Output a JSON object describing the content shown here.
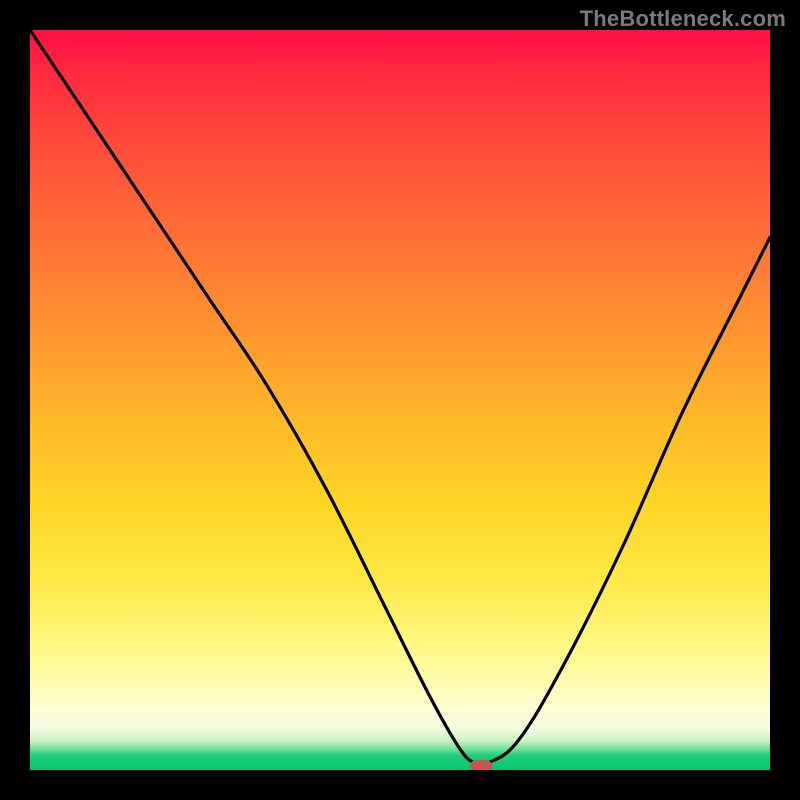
{
  "watermark": "TheBottleneck.com",
  "colors": {
    "frame_bg": "#000000",
    "curve_stroke": "#000000",
    "marker_fill": "#c9564e"
  },
  "chart_data": {
    "type": "line",
    "title": "",
    "xlabel": "",
    "ylabel": "",
    "xlim": [
      0,
      100
    ],
    "ylim": [
      0,
      100
    ],
    "grid": false,
    "legend": false,
    "annotations": [
      {
        "text": "TheBottleneck.com",
        "role": "watermark"
      }
    ],
    "series": [
      {
        "name": "bottleneck-curve",
        "x": [
          0,
          8,
          16,
          24,
          32,
          40,
          48,
          54,
          58,
          60,
          62,
          66,
          72,
          80,
          88,
          96,
          100
        ],
        "values": [
          100,
          88,
          76,
          64,
          52,
          38,
          22,
          10,
          3,
          1,
          1,
          4,
          14,
          30,
          48,
          64,
          72
        ]
      }
    ],
    "marker": {
      "x": 61,
      "y": 0.5
    },
    "background_gradient": {
      "orientation": "vertical",
      "stops": [
        {
          "pos": 0.0,
          "color": "#ff1045"
        },
        {
          "pos": 0.28,
          "color": "#ff7035"
        },
        {
          "pos": 0.64,
          "color": "#ffd524"
        },
        {
          "pos": 0.92,
          "color": "#fdfdd6"
        },
        {
          "pos": 0.98,
          "color": "#1fd07c"
        },
        {
          "pos": 1.0,
          "color": "#05c66f"
        }
      ]
    }
  }
}
